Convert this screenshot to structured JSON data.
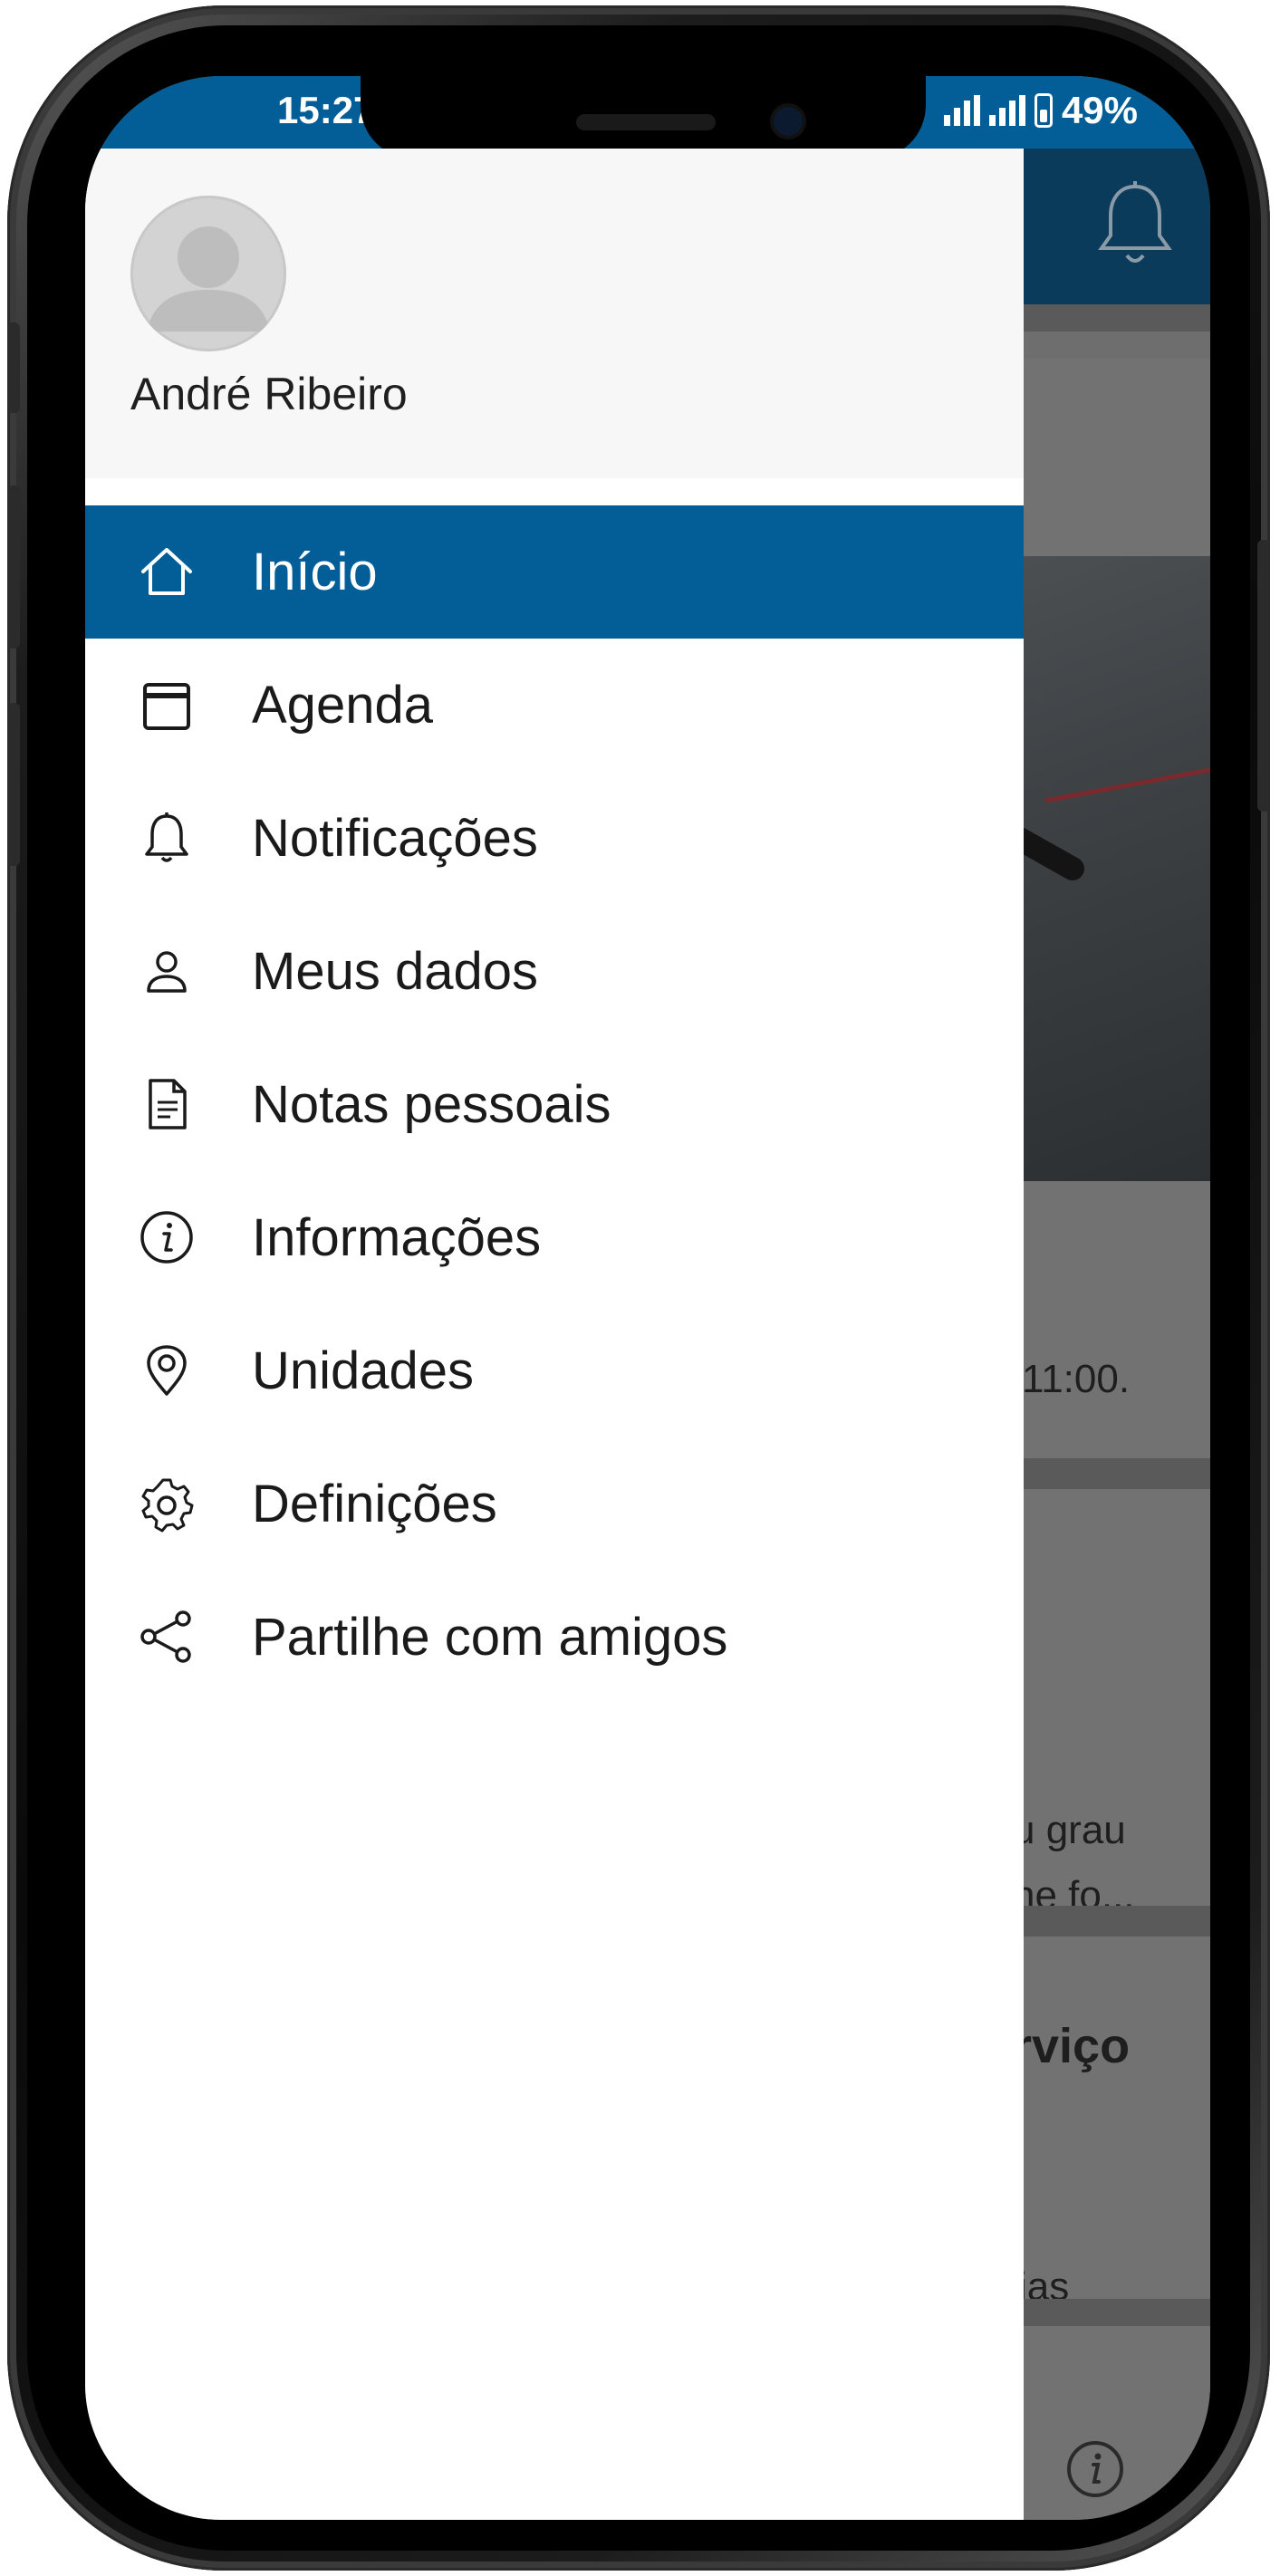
{
  "status_bar": {
    "time": "15:27",
    "battery": "49%",
    "signal_bars": 2,
    "battery_level": 0.49
  },
  "drawer": {
    "user_name": "André Ribeiro",
    "menu": [
      {
        "label": "Início",
        "icon": "home-icon",
        "active": true
      },
      {
        "label": "Agenda",
        "icon": "calendar-icon",
        "active": false
      },
      {
        "label": "Notificações",
        "icon": "bell-icon",
        "active": false
      },
      {
        "label": "Meus dados",
        "icon": "user-icon",
        "active": false
      },
      {
        "label": "Notas pessoais",
        "icon": "document-icon",
        "active": false
      },
      {
        "label": "Informações",
        "icon": "info-icon",
        "active": false
      },
      {
        "label": "Unidades",
        "icon": "location-pin-icon",
        "active": false
      },
      {
        "label": "Definições",
        "icon": "gear-icon",
        "active": false
      },
      {
        "label": "Partilhe com amigos",
        "icon": "share-icon",
        "active": false
      }
    ]
  },
  "background": {
    "snippet_time": "11:00.",
    "snippet_line1": "u grau",
    "snippet_line2": "ne fo...",
    "snippet_title": "rviço",
    "snippet_dias": "ias"
  },
  "colors": {
    "primary": "#035d97",
    "header_dark": "#0a3b5b",
    "drawer_header": "#f7f7f7",
    "text": "#1a1a1a"
  }
}
